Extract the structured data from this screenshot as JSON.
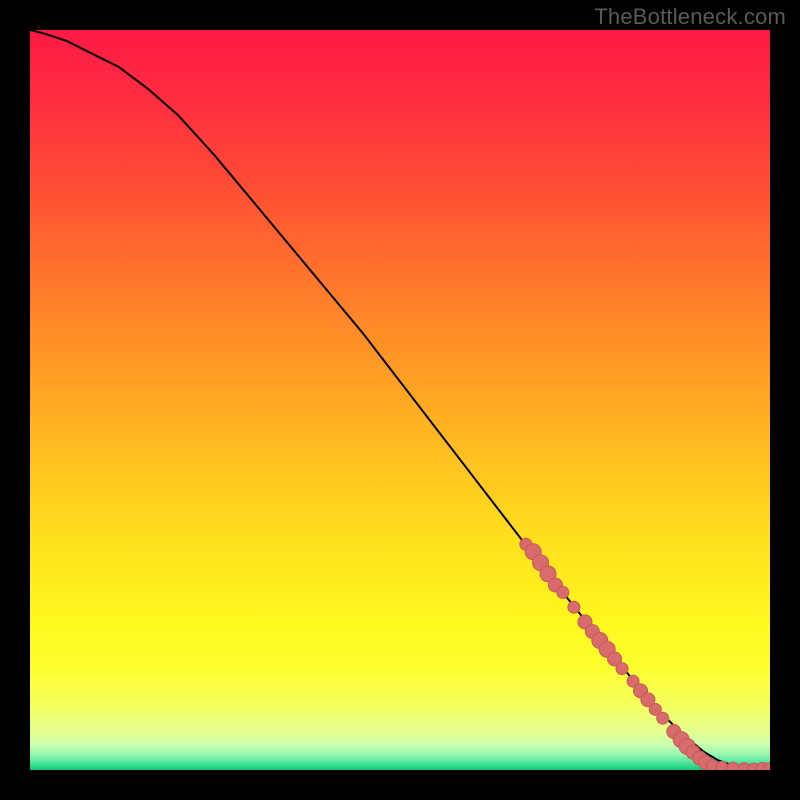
{
  "watermark": "TheBottleneck.com",
  "colors": {
    "background_stops": [
      {
        "offset": 0.0,
        "hex": "#ff1a44"
      },
      {
        "offset": 0.1,
        "hex": "#ff2f3f"
      },
      {
        "offset": 0.2,
        "hex": "#ff4a35"
      },
      {
        "offset": 0.3,
        "hex": "#ff6a2e"
      },
      {
        "offset": 0.4,
        "hex": "#ff8a28"
      },
      {
        "offset": 0.5,
        "hex": "#ffa823"
      },
      {
        "offset": 0.6,
        "hex": "#ffc71f"
      },
      {
        "offset": 0.7,
        "hex": "#ffe31d"
      },
      {
        "offset": 0.8,
        "hex": "#fff81f"
      },
      {
        "offset": 0.86,
        "hex": "#feff2e"
      },
      {
        "offset": 0.91,
        "hex": "#f6ff5c"
      },
      {
        "offset": 0.945,
        "hex": "#e7ff8a"
      },
      {
        "offset": 0.965,
        "hex": "#ccffae"
      },
      {
        "offset": 0.978,
        "hex": "#9bf7b1"
      },
      {
        "offset": 0.988,
        "hex": "#5ce9a0"
      },
      {
        "offset": 0.996,
        "hex": "#28d988"
      },
      {
        "offset": 1.0,
        "hex": "#14c476"
      }
    ],
    "curve": "#000000",
    "point_fill": "#d86b6b",
    "point_stroke": "#c65858"
  },
  "chart_data": {
    "type": "line",
    "title": "",
    "xlabel": "",
    "ylabel": "",
    "xlim": [
      0,
      100
    ],
    "ylim": [
      0,
      100
    ],
    "series": [
      {
        "name": "curve",
        "x": [
          0,
          2,
          5,
          8,
          12,
          16,
          20,
          25,
          30,
          35,
          40,
          45,
          50,
          55,
          60,
          65,
          70,
          74,
          78,
          82,
          85,
          88,
          91,
          93,
          95,
          97,
          98.5,
          100
        ],
        "y": [
          100,
          99.5,
          98.5,
          97,
          95,
          92,
          88.5,
          83,
          77,
          71,
          65,
          59,
          52.5,
          46,
          39.5,
          33,
          26.5,
          21.5,
          16.5,
          11.5,
          8,
          5,
          2.5,
          1.3,
          0.6,
          0.25,
          0.1,
          0.05
        ]
      }
    ],
    "points": {
      "name": "highlighted-points",
      "fill": "#d86b6b",
      "coords": [
        {
          "x": 67,
          "y": 30.5,
          "r": 6
        },
        {
          "x": 68,
          "y": 29.5,
          "r": 8
        },
        {
          "x": 69,
          "y": 28,
          "r": 8
        },
        {
          "x": 70,
          "y": 26.5,
          "r": 8
        },
        {
          "x": 71,
          "y": 25,
          "r": 7
        },
        {
          "x": 72,
          "y": 24,
          "r": 6
        },
        {
          "x": 73.5,
          "y": 22,
          "r": 6
        },
        {
          "x": 75,
          "y": 20,
          "r": 7
        },
        {
          "x": 76,
          "y": 18.7,
          "r": 7
        },
        {
          "x": 77,
          "y": 17.5,
          "r": 8
        },
        {
          "x": 78,
          "y": 16.3,
          "r": 8
        },
        {
          "x": 79,
          "y": 15,
          "r": 7
        },
        {
          "x": 80,
          "y": 13.7,
          "r": 6
        },
        {
          "x": 81.5,
          "y": 12,
          "r": 6
        },
        {
          "x": 82.5,
          "y": 10.7,
          "r": 7
        },
        {
          "x": 83.5,
          "y": 9.5,
          "r": 7
        },
        {
          "x": 84.5,
          "y": 8.2,
          "r": 6
        },
        {
          "x": 85.5,
          "y": 7,
          "r": 6
        },
        {
          "x": 87,
          "y": 5.2,
          "r": 7
        },
        {
          "x": 88,
          "y": 4.1,
          "r": 8
        },
        {
          "x": 88.8,
          "y": 3.2,
          "r": 8
        },
        {
          "x": 89.6,
          "y": 2.4,
          "r": 7
        },
        {
          "x": 90.5,
          "y": 1.6,
          "r": 7
        },
        {
          "x": 91.3,
          "y": 1.0,
          "r": 7
        },
        {
          "x": 92.2,
          "y": 0.6,
          "r": 6
        },
        {
          "x": 93.5,
          "y": 0.35,
          "r": 6
        },
        {
          "x": 95,
          "y": 0.25,
          "r": 6
        },
        {
          "x": 96.5,
          "y": 0.18,
          "r": 6
        },
        {
          "x": 97.8,
          "y": 0.12,
          "r": 6
        },
        {
          "x": 99,
          "y": 0.08,
          "r": 7
        },
        {
          "x": 100,
          "y": 0.06,
          "r": 7
        }
      ]
    }
  }
}
